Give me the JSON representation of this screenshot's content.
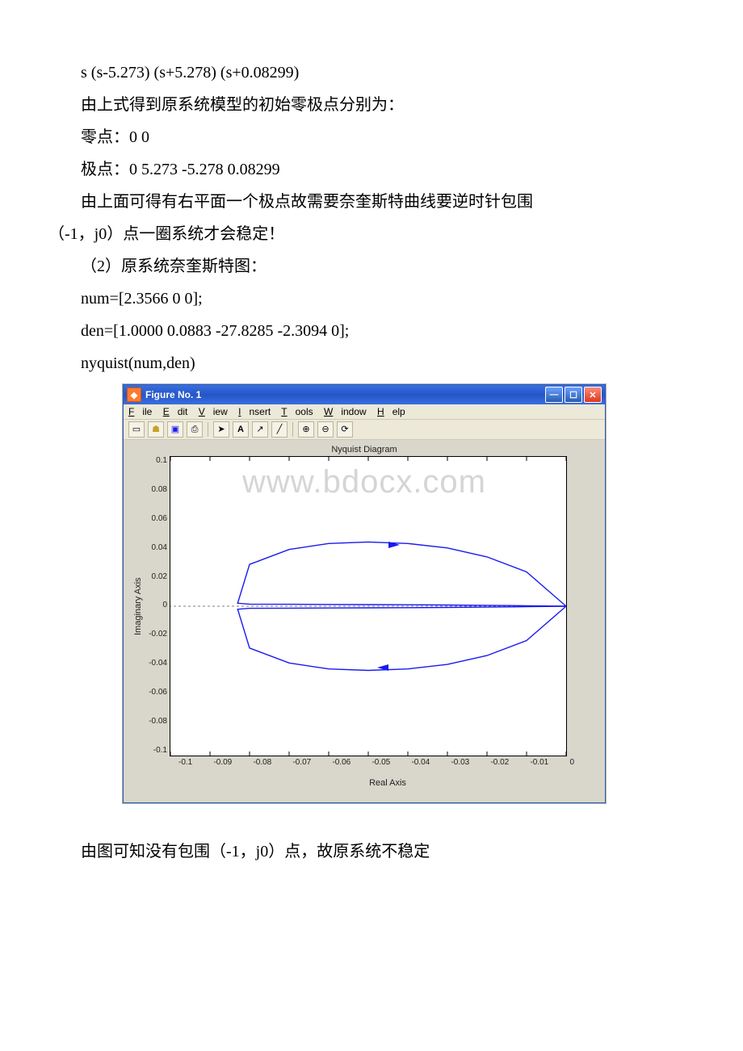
{
  "text": {
    "p1": "s (s-5.273) (s+5.278) (s+0.08299)",
    "p2": "由上式得到原系统模型的初始零极点分别为：",
    "p3": "零点：0  0",
    "p4": "极点：0  5.273  -5.278 0.08299",
    "p5a": "由上面可得有右平面一个极点故需要奈奎斯特曲线要逆时针包围",
    "p5b": "（-1，j0）点一圈系统才会稳定！",
    "p6": "（2）原系统奈奎斯特图：",
    "p7": "num=[2.3566 0 0];",
    "p8": "den=[1.0000 0.0883 -27.8285 -2.3094 0];",
    "p9": "nyquist(num,den)",
    "p10": "由图可知没有包围（-1，j0）点，故原系统不稳定"
  },
  "window": {
    "title": "Figure No. 1",
    "menus": [
      "File",
      "Edit",
      "View",
      "Insert",
      "Tools",
      "Window",
      "Help"
    ],
    "toolbar_icons": [
      "new-icon",
      "open-icon",
      "save-icon",
      "print-icon",
      "pointer-icon",
      "text-icon",
      "arrow-icon",
      "line-icon",
      "zoom-in-icon",
      "zoom-out-icon",
      "rotate-icon"
    ]
  },
  "chart_data": {
    "type": "line",
    "title": "Nyquist Diagram",
    "xlabel": "Real Axis",
    "ylabel": "Imaginary Axis",
    "xlim": [
      -0.1,
      0
    ],
    "ylim": [
      -0.1,
      0.1
    ],
    "xticks": [
      "-0.1",
      "-0.09",
      "-0.08",
      "-0.07",
      "-0.06",
      "-0.05",
      "-0.04",
      "-0.03",
      "-0.02",
      "-0.01",
      "0"
    ],
    "yticks": [
      "0.1",
      "0.08",
      "0.06",
      "0.04",
      "0.02",
      "0",
      "-0.02",
      "-0.04",
      "-0.06",
      "-0.08",
      "-0.1"
    ],
    "series": [
      {
        "name": "nyquist-upper",
        "color": "#1a1af0",
        "x": [
          0,
          -0.01,
          -0.02,
          -0.03,
          -0.04,
          -0.05,
          -0.06,
          -0.07,
          -0.08,
          -0.083,
          -0.08,
          -0.07,
          -0.06,
          -0.05,
          -0.04,
          -0.03,
          -0.02,
          -0.01,
          0
        ],
        "y": [
          0,
          0.023,
          0.033,
          0.039,
          0.042,
          0.043,
          0.042,
          0.038,
          0.028,
          0.002,
          0.0014,
          0.0013,
          0.0012,
          0.0011,
          0.001,
          0.0008,
          0.0006,
          0.0003,
          0
        ]
      },
      {
        "name": "nyquist-lower",
        "color": "#1a1af0",
        "x": [
          0,
          -0.01,
          -0.02,
          -0.03,
          -0.04,
          -0.05,
          -0.06,
          -0.07,
          -0.08,
          -0.083,
          -0.08,
          -0.07,
          -0.06,
          -0.05,
          -0.04,
          -0.03,
          -0.02,
          -0.01,
          0
        ],
        "y": [
          0,
          -0.023,
          -0.033,
          -0.039,
          -0.042,
          -0.043,
          -0.042,
          -0.038,
          -0.028,
          -0.002,
          -0.0014,
          -0.0013,
          -0.0012,
          -0.0011,
          -0.001,
          -0.0008,
          -0.0006,
          -0.0003,
          0
        ]
      }
    ],
    "arrows": [
      {
        "x": -0.045,
        "y": 0.043,
        "dir": "right"
      },
      {
        "x": -0.045,
        "y": -0.043,
        "dir": "left"
      }
    ],
    "reference_line": {
      "y": 0,
      "style": "dashed"
    }
  },
  "watermark": "www.bdocx.com"
}
